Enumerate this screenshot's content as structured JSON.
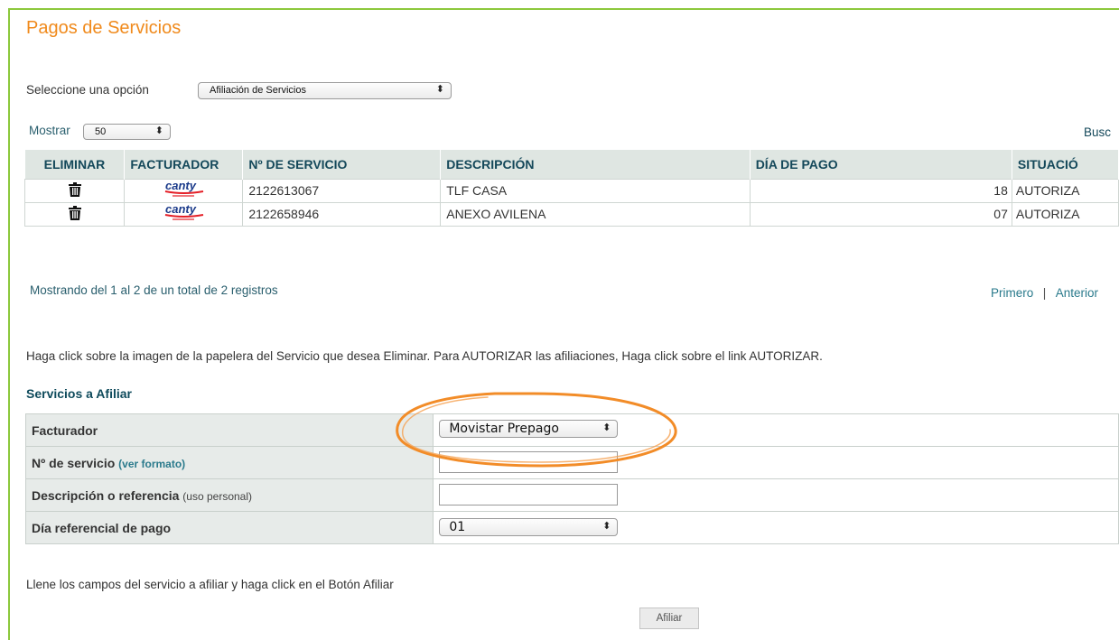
{
  "page": {
    "title": "Pagos de Servicios"
  },
  "option": {
    "label": "Seleccione una opción",
    "selected": "Afiliación de Servicios"
  },
  "show": {
    "label": "Mostrar",
    "selected": "50"
  },
  "search": {
    "label": "Busc"
  },
  "table": {
    "headers": [
      "ELIMINAR",
      "FACTURADOR",
      "Nº DE SERVICIO",
      "DESCRIPCIÓN",
      "DÍA DE PAGO",
      "SITUACIÓ"
    ],
    "rows": [
      {
        "biller": "canty",
        "service": "2122613067",
        "description": "TLF CASA",
        "day": "18",
        "status": "AUTORIZA"
      },
      {
        "biller": "canty",
        "service": "2122658946",
        "description": "ANEXO AVILENA",
        "day": "07",
        "status": "AUTORIZA"
      }
    ]
  },
  "pagination": {
    "summary": "Mostrando del 1 al 2 de un total de 2 registros",
    "first": "Primero",
    "sep": "|",
    "prev": "Anterior"
  },
  "help": "Haga click sobre la imagen de la papelera del Servicio que desea Eliminar. Para AUTORIZAR las afiliaciones, Haga click sobre el link AUTORIZAR.",
  "form": {
    "heading": "Servicios a Afiliar",
    "biller_label": "Facturador",
    "biller_value": "Movistar Prepago",
    "service_label": "Nº de servicio",
    "service_format": "(ver formato)",
    "desc_label": "Descripción o referencia",
    "desc_note": "(uso personal)",
    "day_label": "Día referencial de pago",
    "day_value": "01"
  },
  "footer": {
    "instructions": "Llene los campos del servicio a afiliar y haga click en el Botón Afiliar",
    "submit": "Afiliar"
  },
  "colors": {
    "accent": "#f08a1c",
    "frame": "#8cc83c",
    "header_bg": "#dfe6e2",
    "header_text": "#14485a",
    "annotation": "#f28c28"
  },
  "icons": {
    "delete": "trash-icon",
    "dropdown": "chevron-updown-icon"
  }
}
